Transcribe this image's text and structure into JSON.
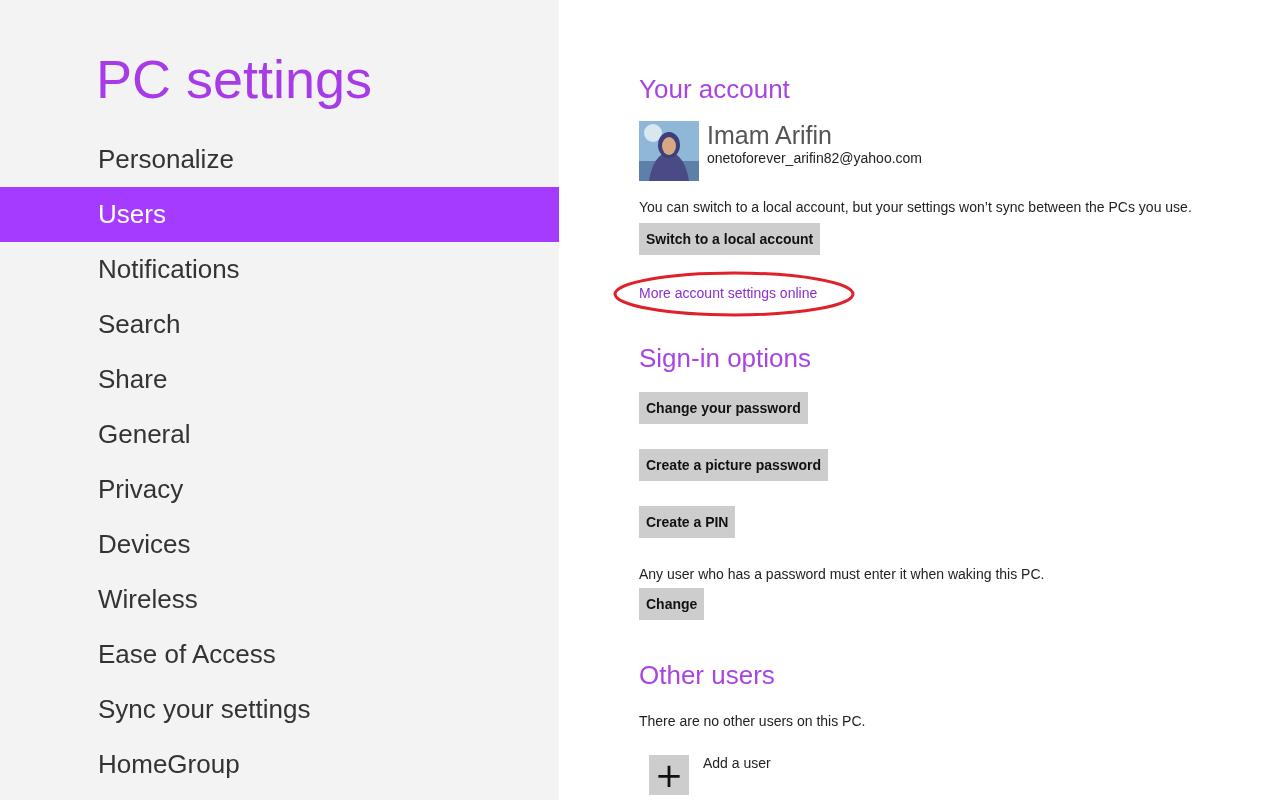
{
  "sidebar": {
    "title": "PC settings",
    "items": [
      {
        "label": "Personalize",
        "selected": false
      },
      {
        "label": "Users",
        "selected": true
      },
      {
        "label": "Notifications",
        "selected": false
      },
      {
        "label": "Search",
        "selected": false
      },
      {
        "label": "Share",
        "selected": false
      },
      {
        "label": "General",
        "selected": false
      },
      {
        "label": "Privacy",
        "selected": false
      },
      {
        "label": "Devices",
        "selected": false
      },
      {
        "label": "Wireless",
        "selected": false
      },
      {
        "label": "Ease of Access",
        "selected": false
      },
      {
        "label": "Sync your settings",
        "selected": false
      },
      {
        "label": "HomeGroup",
        "selected": false
      }
    ]
  },
  "account": {
    "heading": "Your account",
    "name": "Imam Arifin",
    "email": "onetoforever_arifin82@yahoo.com",
    "note": "You can switch to a local account, but your settings won’t sync between the PCs you use.",
    "button": "Switch to a local account",
    "link": {
      "label": "More account settings online",
      "highlighted": true
    }
  },
  "sign_in": {
    "heading": "Sign-in options",
    "buttons": [
      "Change your password",
      "Create a picture password",
      "Create a PIN"
    ],
    "note": "Any user who has a password must enter it when waking this PC.",
    "button": "Change"
  },
  "other_users": {
    "heading": "Other users",
    "note": "There are no other users on this PC.",
    "add": {
      "icon": "+",
      "label": "Add a user"
    }
  }
}
